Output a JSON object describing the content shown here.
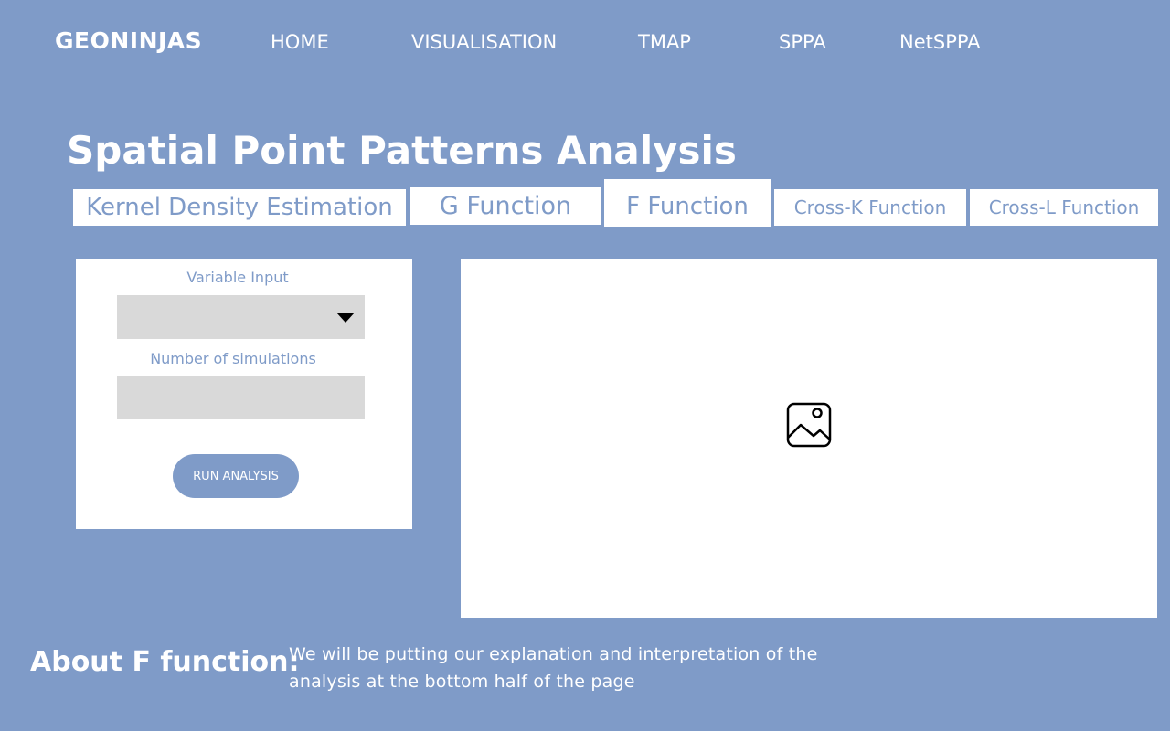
{
  "nav": {
    "brand": "GEONINJAS",
    "links": [
      "HOME",
      "VISUALISATION",
      "TMAP",
      "SPPA",
      "NetSPPA"
    ]
  },
  "page": {
    "title": "Spatial Point Patterns Analysis"
  },
  "tabs": [
    {
      "label": "Kernel Density Estimation",
      "active": false
    },
    {
      "label": "G Function",
      "active": false
    },
    {
      "label": "F Function",
      "active": true
    },
    {
      "label": "Cross-K Function",
      "active": false
    },
    {
      "label": "Cross-L Function",
      "active": false
    }
  ],
  "controls": {
    "variable_label": "Variable Input",
    "variable_value": "",
    "simulations_label": "Number of simulations",
    "simulations_value": "",
    "run_button": "RUN ANALYSIS"
  },
  "output": {
    "placeholder_icon": "image-icon"
  },
  "about": {
    "heading": "About F function:",
    "text": "We will be putting our explanation and interpretation of the analysis at the bottom half of the page"
  },
  "colors": {
    "background": "#7f9bc8",
    "panel": "#ffffff",
    "input": "#d9d9d9",
    "accent": "#7f9bc8"
  }
}
